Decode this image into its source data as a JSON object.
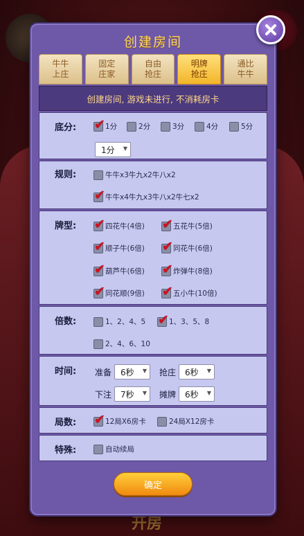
{
  "dialog": {
    "title": "创建房间",
    "notice": "创建房间, 游戏未进行, 不消耗房卡",
    "confirm_label": "确定"
  },
  "tabs": [
    {
      "label": "牛牛\n上庄",
      "active": false
    },
    {
      "label": "固定\n庄家",
      "active": false
    },
    {
      "label": "自由\n抢庄",
      "active": false
    },
    {
      "label": "明牌\n抢庄",
      "active": true
    },
    {
      "label": "通比\n牛牛",
      "active": false
    }
  ],
  "sections": {
    "base_score": {
      "label": "底分:",
      "options": [
        {
          "label": "1分",
          "checked": true
        },
        {
          "label": "2分",
          "checked": false
        },
        {
          "label": "3分",
          "checked": false
        },
        {
          "label": "4分",
          "checked": false
        },
        {
          "label": "5分",
          "checked": false
        }
      ],
      "select_value": "1分"
    },
    "rules": {
      "label": "规则:",
      "options": [
        {
          "label": "牛牛x3牛九x2牛八x2",
          "checked": false
        },
        {
          "label": "牛牛x4牛九x3牛八x2牛七x2",
          "checked": true
        }
      ]
    },
    "card_types": {
      "label": "牌型:",
      "options": [
        {
          "label": "四花牛(4倍)",
          "checked": true
        },
        {
          "label": "五花牛(5倍)",
          "checked": true
        },
        {
          "label": "顺子牛(6倍)",
          "checked": true
        },
        {
          "label": "同花牛(6倍)",
          "checked": true
        },
        {
          "label": "葫芦牛(6倍)",
          "checked": true
        },
        {
          "label": "炸弹牛(8倍)",
          "checked": true
        },
        {
          "label": "同花顺(9倍)",
          "checked": true
        },
        {
          "label": "五小牛(10倍)",
          "checked": true
        }
      ]
    },
    "multiplier": {
      "label": "倍数:",
      "options": [
        {
          "label": "1、2、4、5",
          "checked": false
        },
        {
          "label": "1、3、5、8",
          "checked": true
        },
        {
          "label": "2、4、6、10",
          "checked": false
        }
      ]
    },
    "time": {
      "label": "时间:",
      "prepare_label": "准备",
      "prepare_value": "6秒",
      "grab_label": "抢庄",
      "grab_value": "6秒",
      "bet_label": "下注",
      "bet_value": "7秒",
      "show_label": "摊牌",
      "show_value": "6秒"
    },
    "rounds": {
      "label": "局数:",
      "options": [
        {
          "label": "12局X6房卡",
          "checked": true
        },
        {
          "label": "24局X12房卡",
          "checked": false
        }
      ]
    },
    "special": {
      "label": "特殊:",
      "options": [
        {
          "label": "自动续局",
          "checked": false
        }
      ]
    }
  },
  "background": {
    "bottom_text": "开房"
  },
  "colors": {
    "dialog_bg": "#6e58a8",
    "panel_bg": "#c6c8f0",
    "title_gold": "#ffd66b",
    "check_red": "#d01020",
    "confirm_orange": "#f08a10"
  }
}
